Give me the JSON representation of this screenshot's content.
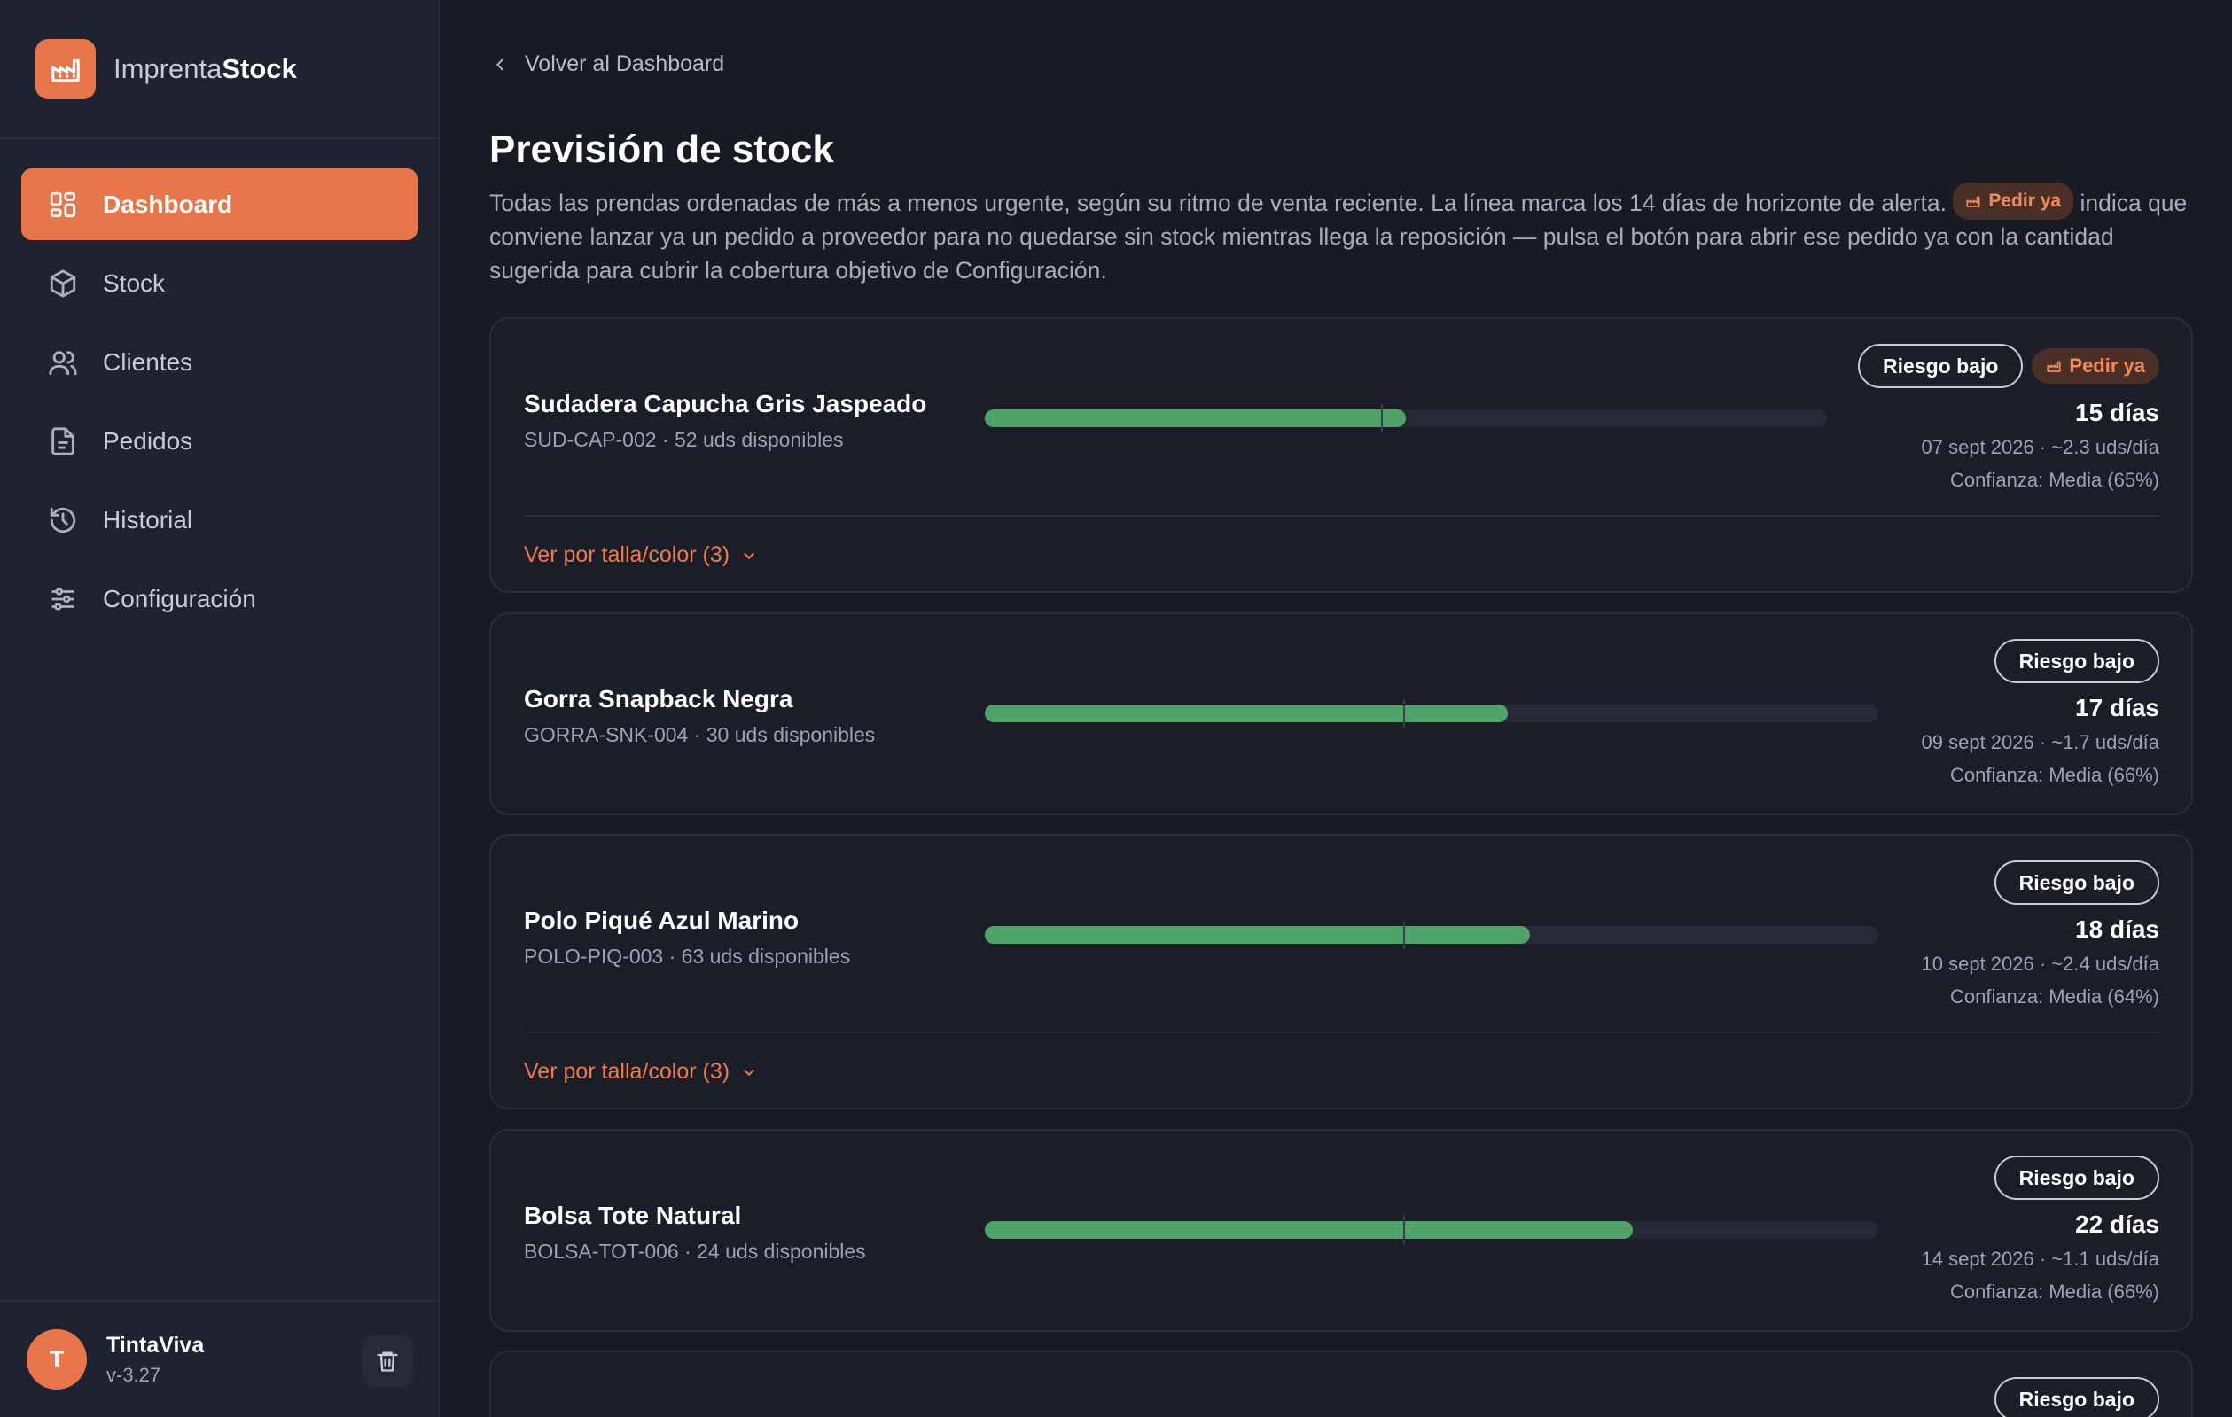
{
  "brand": {
    "name_light": "Imprenta",
    "name_bold": "Stock",
    "accent": "#e8764a"
  },
  "sidebar": {
    "items": [
      {
        "label": "Dashboard",
        "icon": "dashboard-icon",
        "active": true
      },
      {
        "label": "Stock",
        "icon": "box-icon"
      },
      {
        "label": "Clientes",
        "icon": "users-icon"
      },
      {
        "label": "Pedidos",
        "icon": "document-icon"
      },
      {
        "label": "Historial",
        "icon": "history-icon"
      },
      {
        "label": "Configuración",
        "icon": "sliders-icon"
      }
    ]
  },
  "user": {
    "initial": "T",
    "name": "TintaViva",
    "version": "v-3.27"
  },
  "header": {
    "back": "Volver al Dashboard",
    "title": "Previsión de stock",
    "desc_part1": "Todas las prendas ordenadas de más a menos urgente, según su ritmo de venta reciente. La línea marca los 14 días de horizonte de alerta.",
    "desc_pill": "Pedir ya",
    "desc_part2": "indica que conviene lanzar ya un pedido a proveedor para no quedarse sin stock mientras llega la reposición — pulsa el botón para abrir ese pedido ya con la cantidad sugerida para cubrir la cobertura objetivo de Configuración."
  },
  "colors": {
    "bar_fill": "#4fa36a",
    "order_text": "#f08a5d"
  },
  "products": [
    {
      "name": "Sudadera Capucha Gris Jaspeado",
      "meta": "SUD-CAP-002 · 52 uds disponibles",
      "risk": "Riesgo bajo",
      "order": "Pedir ya",
      "days": "15 días",
      "detail": "07 sept 2026 · ~2.3 uds/día",
      "confidence": "Confianza: Media (65%)",
      "coverage_fraction": 0.5,
      "alert_fraction": 0.47,
      "expand": "Ver por talla/color (3)"
    },
    {
      "name": "Gorra Snapback Negra",
      "meta": "GORRA-SNK-004 · 30 uds disponibles",
      "risk": "Riesgo bajo",
      "days": "17 días",
      "detail": "09 sept 2026 · ~1.7 uds/día",
      "confidence": "Confianza: Media (66%)",
      "coverage_fraction": 0.585,
      "alert_fraction": 0.468
    },
    {
      "name": "Polo Piqué Azul Marino",
      "meta": "POLO-PIQ-003 · 63 uds disponibles",
      "risk": "Riesgo bajo",
      "days": "18 días",
      "detail": "10 sept 2026 · ~2.4 uds/día",
      "confidence": "Confianza: Media (64%)",
      "coverage_fraction": 0.61,
      "alert_fraction": 0.468,
      "expand": "Ver por talla/color (3)"
    },
    {
      "name": "Bolsa Tote Natural",
      "meta": "BOLSA-TOT-006 · 24 uds disponibles",
      "risk": "Riesgo bajo",
      "days": "22 días",
      "detail": "14 sept 2026 · ~1.1 uds/día",
      "confidence": "Confianza: Media (66%)",
      "coverage_fraction": 0.725,
      "alert_fraction": 0.468
    },
    {
      "risk": "Riesgo bajo"
    }
  ]
}
